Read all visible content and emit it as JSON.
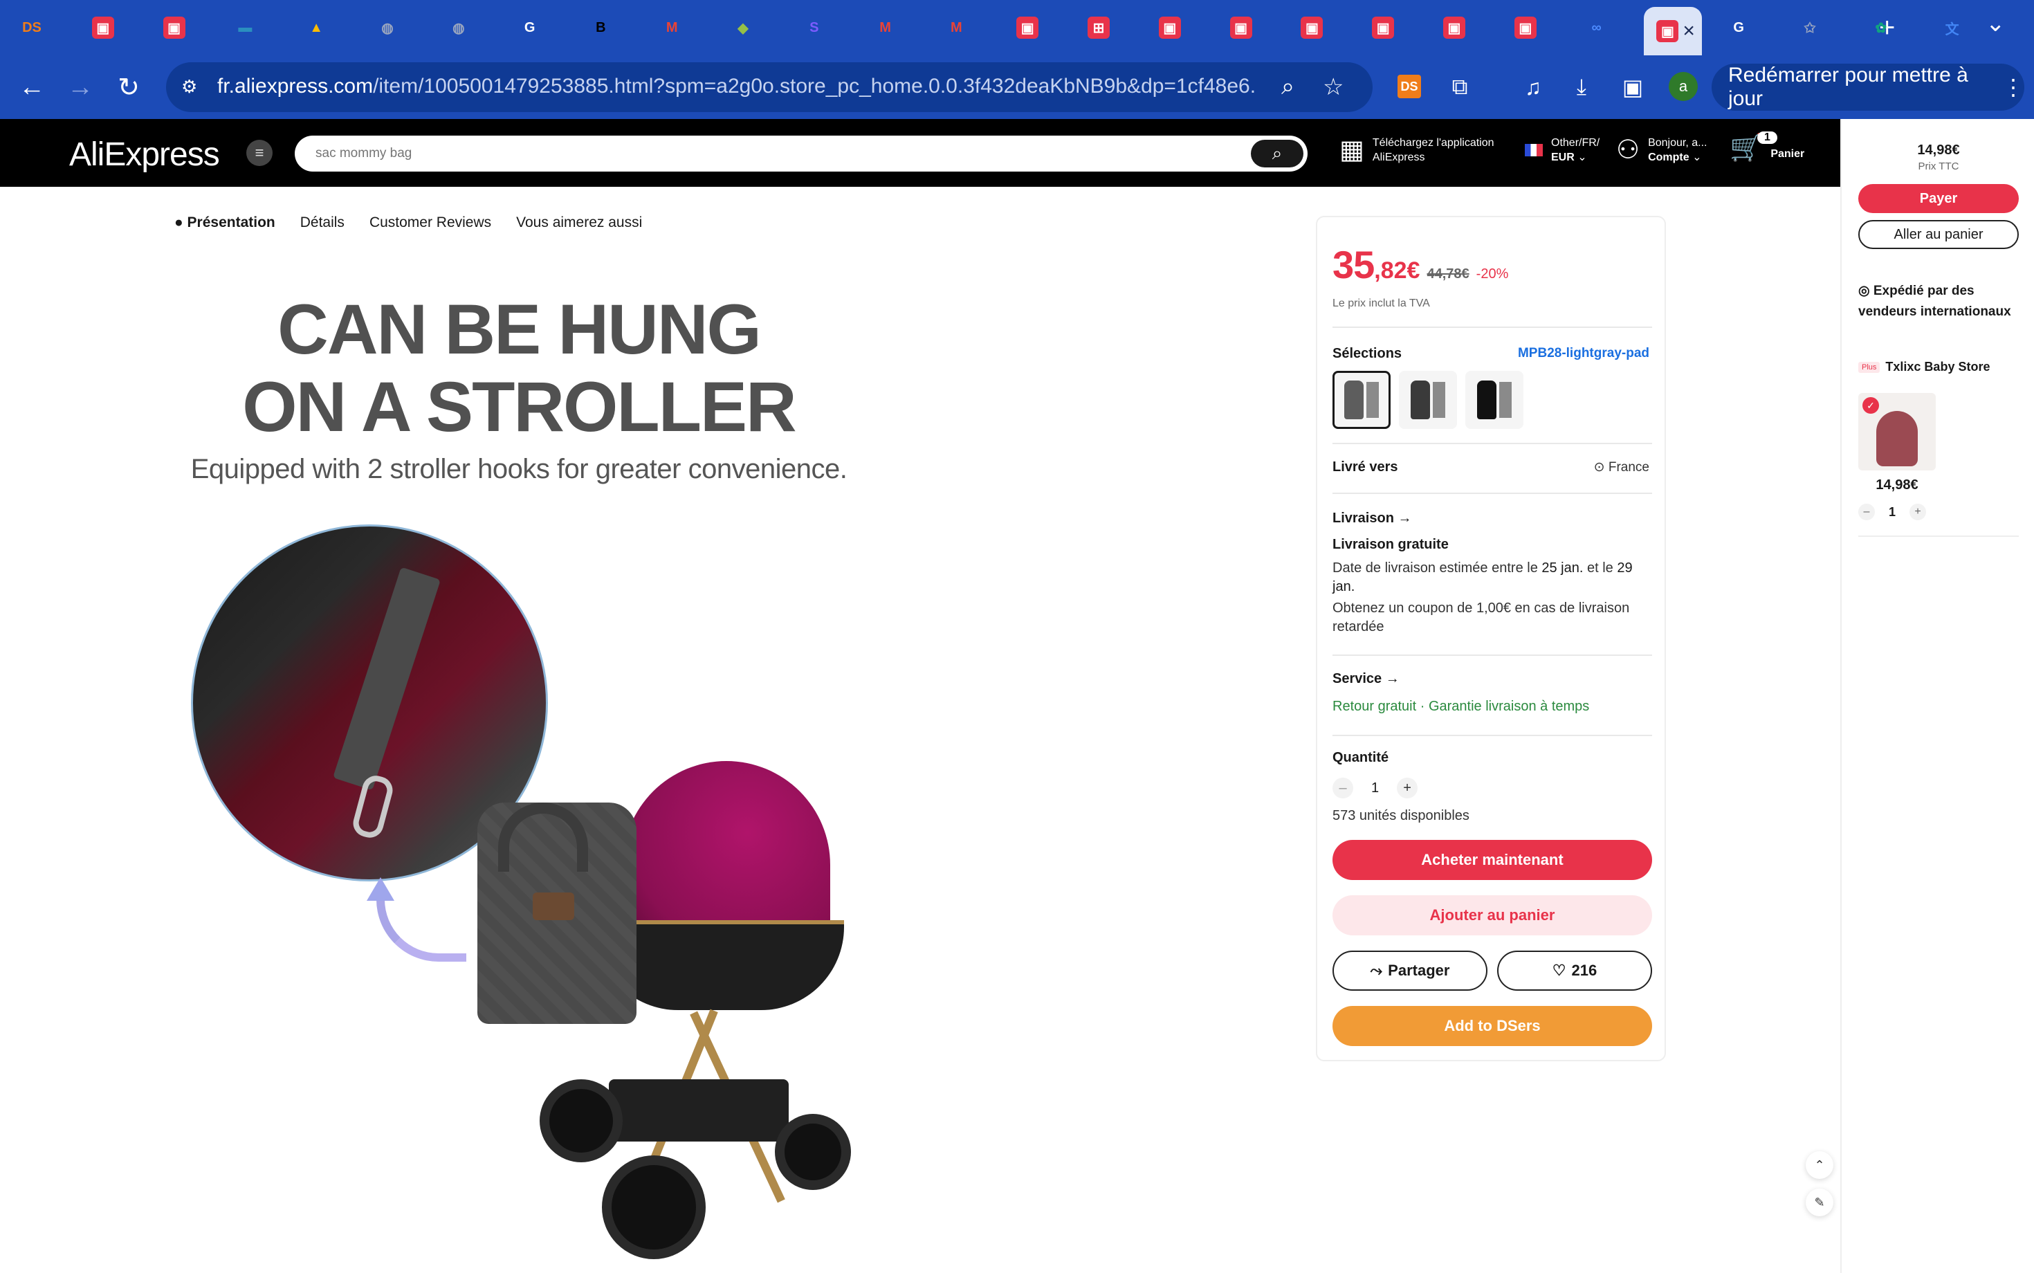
{
  "browser": {
    "tabs": [
      {
        "icon": "dsers-icon",
        "label": "DS",
        "color": "#f07d1a"
      },
      {
        "icon": "aliexpress-icon",
        "color": "#e8334a"
      },
      {
        "icon": "aliexpress-icon",
        "color": "#e8334a"
      },
      {
        "icon": "card-icon",
        "color": "#2a8fbf"
      },
      {
        "icon": "google-ads-icon",
        "color": "#fbbc04"
      },
      {
        "icon": "globe-icon",
        "color": "#9aa6bf"
      },
      {
        "icon": "globe-icon",
        "color": "#9aa6bf"
      },
      {
        "icon": "google-icon",
        "color": "#ffffff"
      },
      {
        "icon": "b-icon",
        "label": "B",
        "color": "#000000"
      },
      {
        "icon": "gmail-icon",
        "color": "#ea4335"
      },
      {
        "icon": "shopify-icon",
        "color": "#95bf47"
      },
      {
        "icon": "s-icon",
        "label": "S",
        "color": "#7c5cff"
      },
      {
        "icon": "gmail-icon",
        "color": "#ea4335"
      },
      {
        "icon": "gmail-icon",
        "color": "#ea4335"
      },
      {
        "icon": "aliexpress-icon",
        "color": "#e8334a"
      },
      {
        "icon": "cart-store-icon",
        "color": "#e8334a"
      },
      {
        "icon": "aliexpress-icon",
        "color": "#e8334a"
      },
      {
        "icon": "aliexpress-icon",
        "color": "#e8334a"
      },
      {
        "icon": "aliexpress-icon",
        "color": "#e8334a"
      },
      {
        "icon": "aliexpress-icon",
        "color": "#e8334a"
      },
      {
        "icon": "aliexpress-icon",
        "color": "#e8334a"
      },
      {
        "icon": "aliexpress-icon",
        "color": "#e8334a"
      },
      {
        "icon": "meta-icon",
        "color": "#4d8bff"
      },
      {
        "icon": "aliexpress-icon",
        "color": "#e8334a",
        "active": true
      },
      {
        "icon": "google-icon",
        "color": "#ffffff"
      },
      {
        "icon": "star-icon",
        "color": "#9aa6bf"
      },
      {
        "icon": "chatgpt-icon",
        "color": "#10a37f"
      },
      {
        "icon": "translate-icon",
        "color": "#4285f4"
      }
    ],
    "url_host": "fr.aliexpress.com",
    "url_path": "/item/1005001479253885.html?spm=a2g0o.store_pc_home.0.0.3f432deaKbNB9b&dp=1cf48e6...",
    "restart_label": "Redémarrer pour mettre à jour"
  },
  "header": {
    "logo": "AliExpress",
    "search_placeholder": "sac mommy bag",
    "app_line1": "Téléchargez l'application",
    "app_line2": "AliExpress",
    "locale_line1": "Other/FR/",
    "locale_line2": "EUR",
    "account_line1": "Bonjour, a...",
    "account_line2": "Compte",
    "cart_count": "1",
    "cart_label": "Panier"
  },
  "anchors": [
    "Présentation",
    "Détails",
    "Customer Reviews",
    "Vous aimerez aussi"
  ],
  "promo": {
    "line1": "CAN BE HUNG",
    "line2": "ON A STROLLER",
    "subtitle": "Equipped with 2 stroller hooks for greater convenience."
  },
  "buybox": {
    "price_int": "35",
    "price_cents": ",82€",
    "old_price": "44,78€",
    "discount": "-20%",
    "vat_note": "Le prix inclut la TVA",
    "selections_label": "Sélections",
    "selected_variant": "MPB28-lightgray-pad",
    "swatches": [
      {
        "bag": "#5d5d5d",
        "selected": true
      },
      {
        "bag": "#3a3a3a",
        "selected": false
      },
      {
        "bag": "#111111",
        "selected": false
      }
    ],
    "ship_to_label": "Livré vers",
    "ship_to_value": "France",
    "delivery_label": "Livraison",
    "delivery_free": "Livraison gratuite",
    "delivery_est_pre": "Date de livraison estimée entre le ",
    "delivery_date1": "25 jan.",
    "delivery_mid": " et le ",
    "delivery_date2": "29 jan.",
    "delivery_coupon": "Obtenez un coupon de 1,00€ en cas de livraison retardée",
    "service_label": "Service",
    "service_return": "Retour gratuit",
    "service_guarantee": "Garantie livraison à temps",
    "qty_label": "Quantité",
    "qty_value": "1",
    "stock": "573 unités disponibles",
    "buy_now": "Acheter maintenant",
    "add_cart": "Ajouter au panier",
    "share": "Partager",
    "wishlist_count": "216",
    "dsers": "Add to DSers"
  },
  "cartpanel": {
    "total": "14,98€",
    "total_note": "Prix TTC",
    "pay": "Payer",
    "go_cart": "Aller au panier",
    "shipping": "Expédié par des vendeurs internationaux",
    "store_tag": "Plus",
    "store": "Txlixc Baby Store",
    "item_price": "14,98€",
    "item_qty": "1"
  }
}
